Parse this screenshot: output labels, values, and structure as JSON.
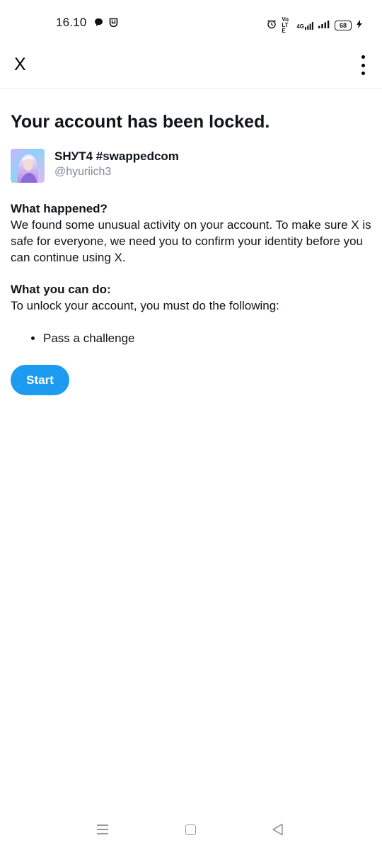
{
  "status_bar": {
    "time": "16.10",
    "volte_label": "Vo LTE",
    "network_label": "4G",
    "battery": "68"
  },
  "header": {
    "logo": "X"
  },
  "page": {
    "title": "Your account has been locked.",
    "account": {
      "display_name": "SHУT4 #swappedcom",
      "handle": "@hyuriich3"
    },
    "what_happened": {
      "heading": "What happened?",
      "body": "We found some unusual activity on your account. To make sure X is safe for everyone, we need you to confirm your identity before you can continue using X."
    },
    "what_you_can_do": {
      "heading": "What you can do:",
      "body": "To unlock your account, you must do the following:"
    },
    "steps": [
      "Pass a challenge"
    ],
    "start_button": "Start"
  },
  "colors": {
    "accent": "#1d9bf0",
    "text": "#0f1419",
    "muted": "#7d8a96"
  }
}
